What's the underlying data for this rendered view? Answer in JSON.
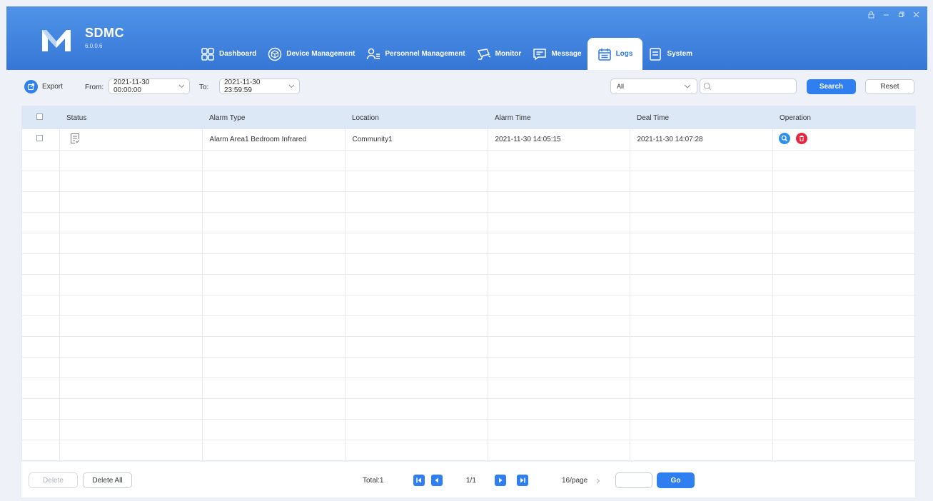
{
  "app": {
    "name": "SDMC",
    "version": "6.0.0.6",
    "logo_letter": "M",
    "accent_color": "#2f7ff0"
  },
  "window_controls": [
    "lock-icon",
    "minimize-icon",
    "restore-icon",
    "close-icon"
  ],
  "nav": {
    "items": [
      {
        "label": "Dashboard",
        "icon": "dashboard-grid-icon"
      },
      {
        "label": "Device Management",
        "icon": "device-box-icon"
      },
      {
        "label": "Personnel Management",
        "icon": "personnel-icon"
      },
      {
        "label": "Monitor",
        "icon": "camera-icon"
      },
      {
        "label": "Message",
        "icon": "message-icon"
      },
      {
        "label": "Logs",
        "icon": "logs-calendar-icon",
        "active": true
      },
      {
        "label": "System",
        "icon": "system-doc-icon"
      }
    ]
  },
  "toolbar": {
    "export_label": "Export",
    "from_label": "From:",
    "from_value": "2021-11-30 00:00:00",
    "to_label": "To:",
    "to_value": "2021-11-30 23:59:59",
    "filter_value": "All",
    "search_placeholder": "",
    "search_label": "Search",
    "reset_label": "Reset"
  },
  "table": {
    "columns": [
      "Status",
      "Alarm Type",
      "Location",
      "Alarm Time",
      "Deal Time",
      "Operation"
    ],
    "rows": [
      {
        "status_icon": "dealt-checklist-icon",
        "alarm_type": "Alarm Area1 Bedroom Infrared",
        "location": "Community1",
        "alarm_time": "2021-11-30 14:05:15",
        "deal_time": "2021-11-30 14:07:28",
        "operations": [
          "view-icon",
          "delete-icon"
        ]
      }
    ],
    "empty_rows": 15
  },
  "footer": {
    "delete_label": "Delete",
    "delete_all_label": "Delete All",
    "total_label": "Total:1",
    "page_indicator": "1/1",
    "page_size": "16/page",
    "goto_value": "",
    "go_label": "Go"
  }
}
